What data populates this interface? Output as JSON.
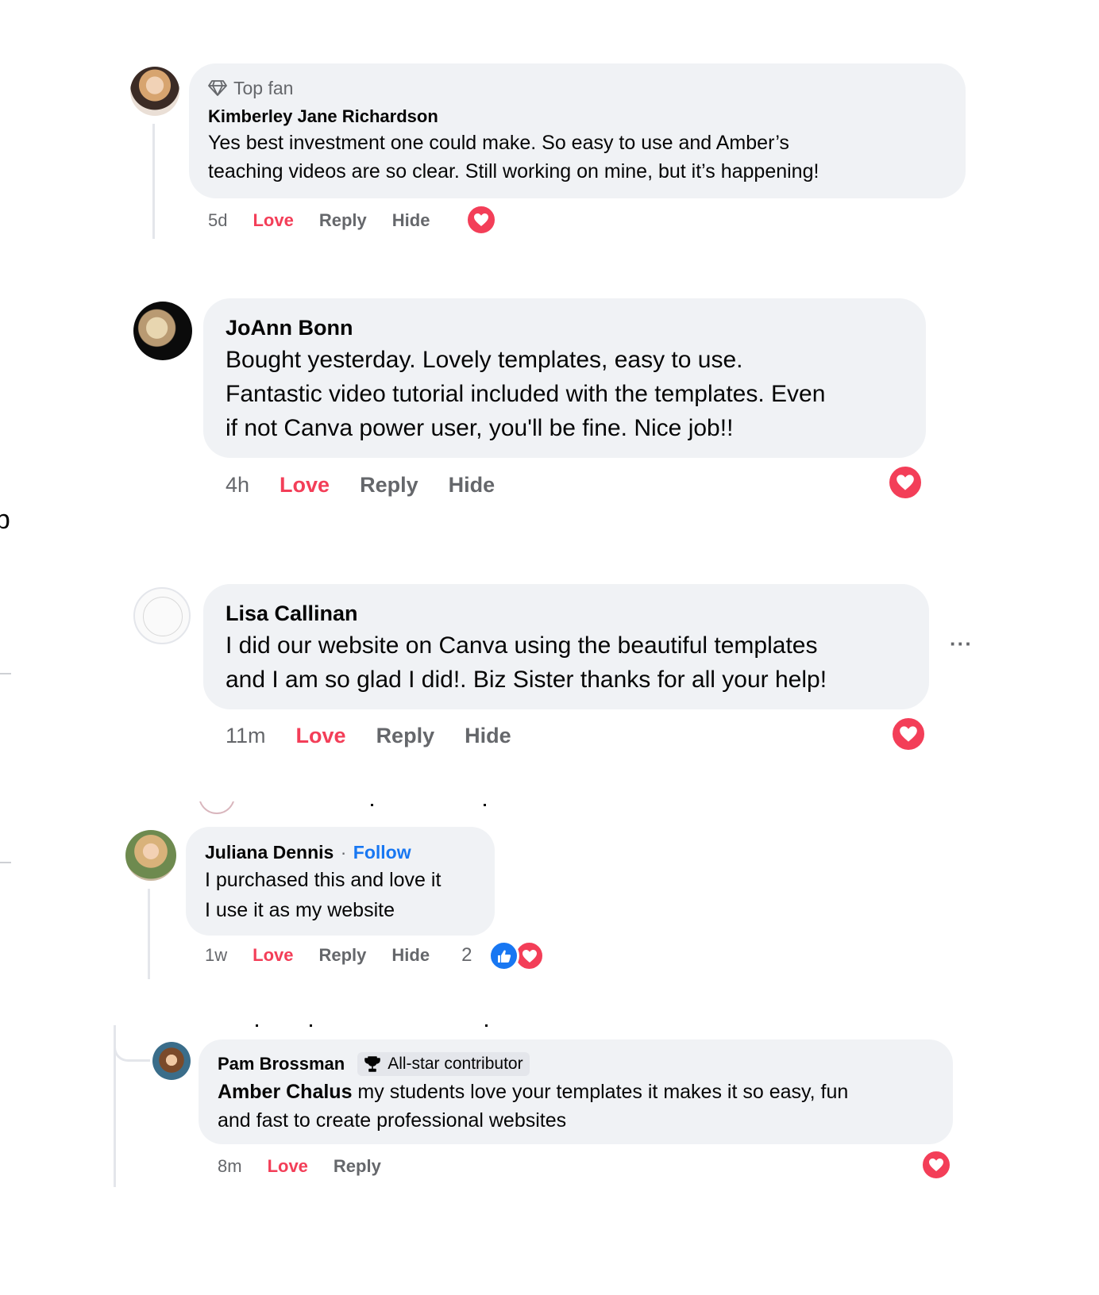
{
  "comments": [
    {
      "badge": "Top fan",
      "badge_icon": "diamond-icon",
      "author": "Kimberley Jane Richardson",
      "text": "Yes best investment one could make. So easy to use and Amber’s\nteaching videos are so clear. Still working on mine, but it’s happening!",
      "time": "5d",
      "love": "Love",
      "reply": "Reply",
      "hide": "Hide",
      "reactions": [
        "heart-icon"
      ]
    },
    {
      "author": "JoAnn Bonn",
      "text": "Bought yesterday. Lovely templates, easy to use.\nFantastic video tutorial included with the templates. Even\nif not Canva power user, you'll be fine. Nice job!!",
      "time": "4h",
      "love": "Love",
      "reply": "Reply",
      "hide": "Hide",
      "reactions": [
        "heart-icon"
      ]
    },
    {
      "author": "Lisa Callinan",
      "text": "I did our website on Canva using the beautiful templates\nand I am so glad I did!. Biz Sister thanks for all your help!",
      "time": "11m",
      "love": "Love",
      "reply": "Reply",
      "hide": "Hide",
      "more": "···",
      "reactions": [
        "heart-icon"
      ]
    },
    {
      "author": "Juliana Dennis",
      "separator": "·",
      "follow": "Follow",
      "text": "I purchased this and love it\nI use it as my website",
      "time": "1w",
      "love": "Love",
      "reply": "Reply",
      "hide": "Hide",
      "reaction_count": "2",
      "reactions": [
        "like-icon",
        "heart-icon"
      ]
    },
    {
      "author": "Pam Brossman",
      "badge": "All-star contributor",
      "badge_icon": "trophy-icon",
      "mention": "Amber Chalus",
      "text": " my students love your templates it makes it so easy, fun\nand fast to create professional websites",
      "time": "8m",
      "love": "Love",
      "reply": "Reply",
      "reactions": [
        "heart-icon"
      ]
    }
  ],
  "edge_fragment": "ɒ",
  "colors": {
    "love": "#f33e58",
    "link": "#1877f2",
    "muted": "#65676b",
    "bubble": "#f0f2f5"
  }
}
